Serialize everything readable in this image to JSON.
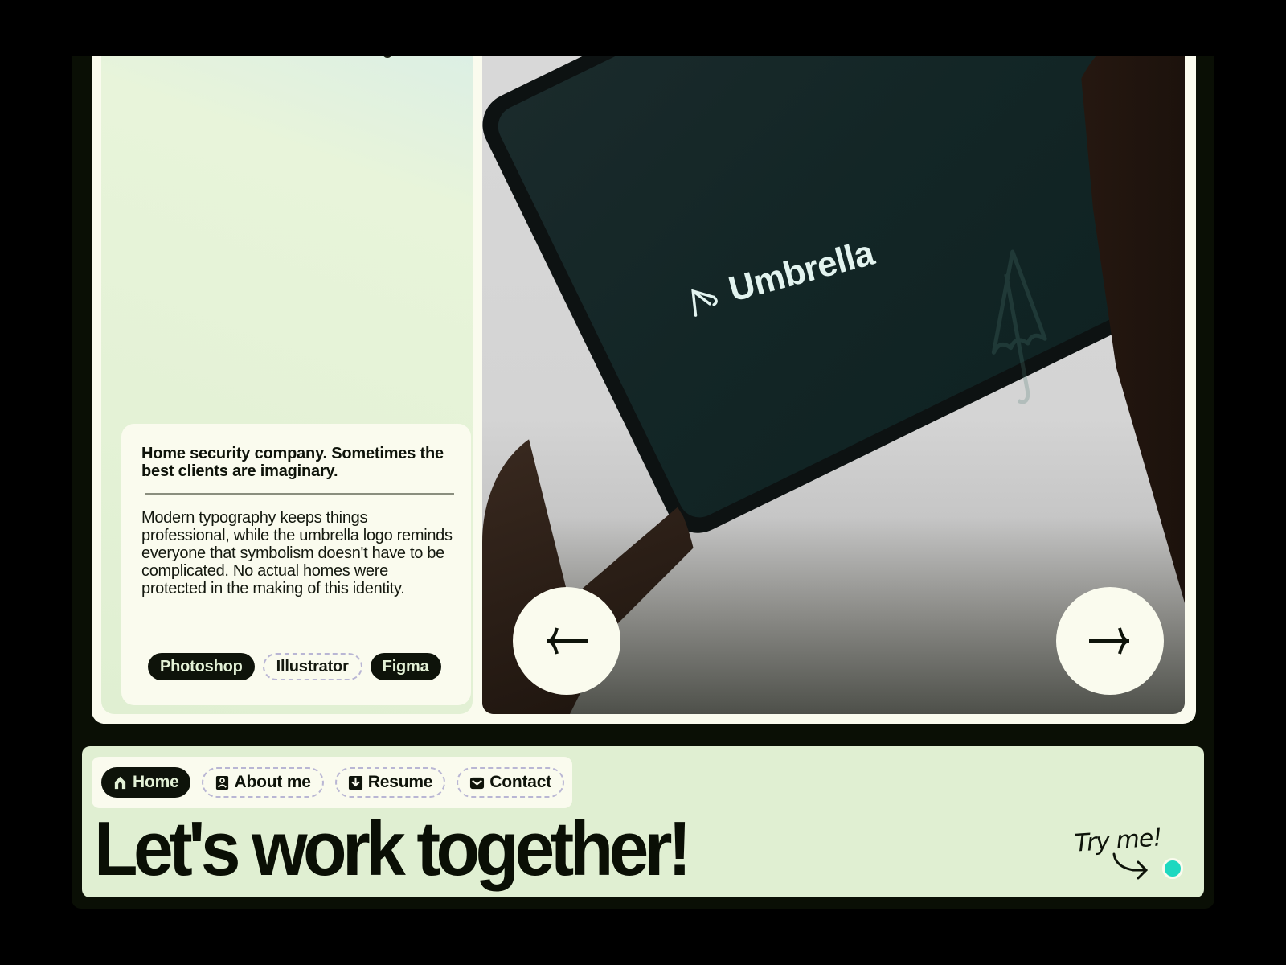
{
  "project": {
    "title": "Home security company. Sometimes the best clients are imaginary.",
    "description": "Modern typography keeps things professional, while the umbrella logo reminds everyone that symbolism doesn't have to be complicated. No actual homes were protected in the making of this identity.",
    "tools": [
      {
        "label": "Photoshop",
        "style": "solid"
      },
      {
        "label": "Illustrator",
        "style": "dashed"
      },
      {
        "label": "Figma",
        "style": "solid"
      }
    ]
  },
  "carousel": {
    "image_brand_text": "Umbrella",
    "prev_icon": "arrow-left-icon",
    "next_icon": "arrow-right-icon"
  },
  "nav": {
    "items": [
      {
        "label": "Home",
        "icon": "home-icon",
        "active": true
      },
      {
        "label": "About me",
        "icon": "person-badge-icon",
        "active": false
      },
      {
        "label": "Resume",
        "icon": "download-icon",
        "active": false
      },
      {
        "label": "Contact",
        "icon": "mail-icon",
        "active": false
      }
    ]
  },
  "headline": "Let's work together!",
  "try_me": "Try me!",
  "colors": {
    "dark": "#0a0f05",
    "cream": "#fafbee",
    "mint": "#e0efd2",
    "accent_teal": "#1ed8c0",
    "dashed_border": "#b9b6d4"
  }
}
